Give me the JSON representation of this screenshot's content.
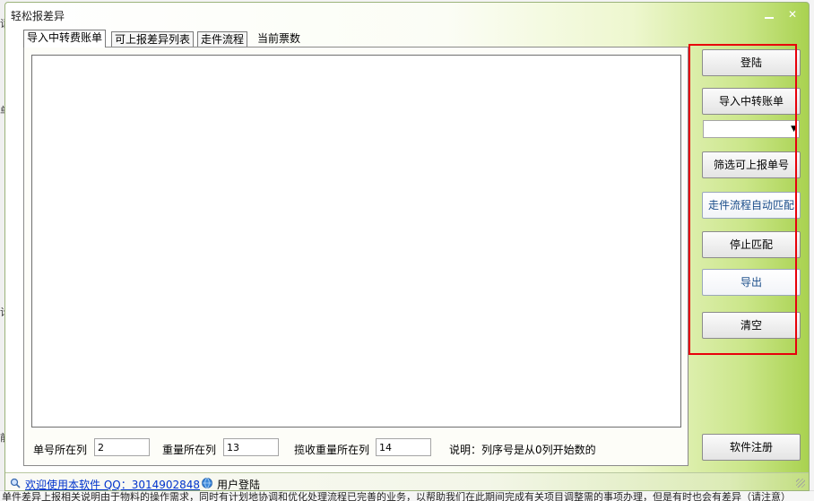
{
  "window": {
    "title": "轻松报差异",
    "minimize_glyph": "",
    "close_glyph": "✕"
  },
  "tabs": [
    {
      "label": "导入中转费账单",
      "active": true
    },
    {
      "label": "可上报差异列表",
      "active": false
    },
    {
      "label": "走件流程",
      "active": false
    },
    {
      "label": "当前票数",
      "active": false
    }
  ],
  "fields": {
    "order_col_label": "单号所在列",
    "order_col_value": "2",
    "weight_col_label": "重量所在列",
    "weight_col_value": "13",
    "collect_weight_col_label": "揽收重量所在列",
    "collect_weight_col_value": "14",
    "note": "说明：列序号是从0列开始数的"
  },
  "buttons": {
    "login": "登陆",
    "import_bill": "导入中转账单",
    "filter": "筛选可上报单号",
    "auto_match": "走件流程自动匹配",
    "stop_match": "停止匹配",
    "export": "导出",
    "clear": "清空",
    "register": "软件注册"
  },
  "combo": {
    "selected": ""
  },
  "status": {
    "welcome": "欢迎使用本软件 QQ：3014902848",
    "user_login": "用户登陆"
  },
  "background": {
    "left_chars": [
      "请",
      "单",
      "计",
      "前"
    ],
    "bottom_text": "单件差异上报相关说明由于物料的操作需求，同时有计划地协调和优化处理流程已完善的业务，以帮助我们在此期间完成有关项目调整需的事项办理，但是有时也会有差异（请注意）"
  },
  "colors": {
    "highlight_box": "#e8000b",
    "link": "#0033cc",
    "title_gradient_end": "#a9d250"
  }
}
